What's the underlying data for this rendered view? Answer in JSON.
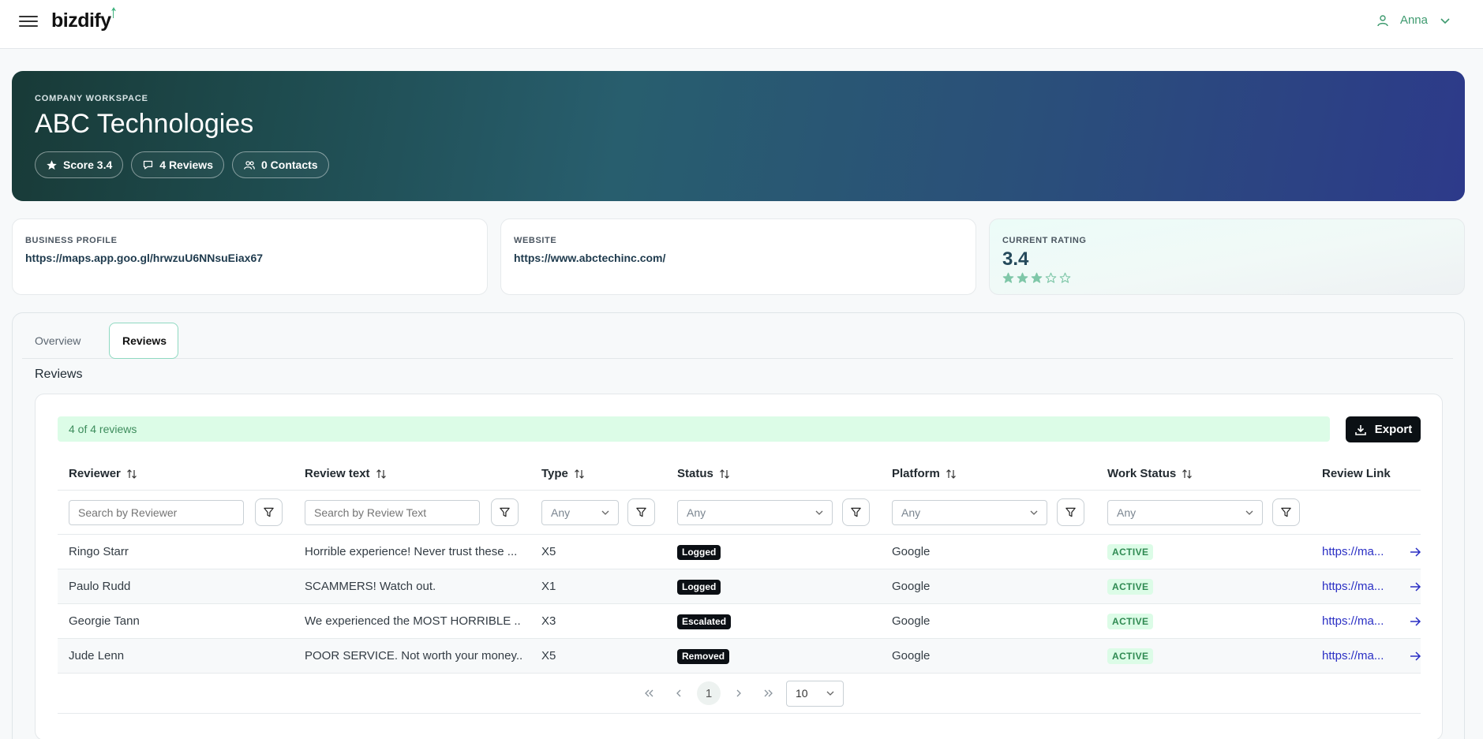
{
  "header": {
    "logo": "bizdify",
    "user_name": "Anna"
  },
  "hero": {
    "eyebrow": "COMPANY WORKSPACE",
    "title": "ABC Technologies",
    "chips": {
      "score": "Score 3.4",
      "reviews": "4 Reviews",
      "contacts": "0 Contacts"
    }
  },
  "cards": {
    "business_profile": {
      "label": "BUSINESS PROFILE",
      "value": "https://maps.app.goo.gl/hrwzuU6NNsuEiax67"
    },
    "website": {
      "label": "WEBSITE",
      "value": "https://www.abctechinc.com/"
    },
    "rating": {
      "label": "CURRENT RATING",
      "value": "3.4",
      "stars_filled": 3,
      "stars_total": 5
    }
  },
  "tabs": {
    "overview": "Overview",
    "reviews": "Reviews"
  },
  "reviews": {
    "section_title": "Reviews",
    "count_text": "4 of 4 reviews",
    "export_label": "Export",
    "columns": {
      "reviewer": "Reviewer",
      "review_text": "Review text",
      "type": "Type",
      "status": "Status",
      "platform": "Platform",
      "work_status": "Work Status",
      "review_link": "Review Link"
    },
    "filters": {
      "reviewer_placeholder": "Search by Reviewer",
      "text_placeholder": "Search by Review Text",
      "type": "Any",
      "status": "Any",
      "platform": "Any",
      "work_status": "Any"
    },
    "rows": [
      {
        "reviewer": "Ringo Starr",
        "text": "Horrible experience! Never trust these ...",
        "type": "X5",
        "status": "Logged",
        "platform": "Google",
        "work_status": "ACTIVE",
        "link": "https://ma..."
      },
      {
        "reviewer": "Paulo Rudd",
        "text": "SCAMMERS! Watch out.",
        "type": "X1",
        "status": "Logged",
        "platform": "Google",
        "work_status": "ACTIVE",
        "link": "https://ma..."
      },
      {
        "reviewer": "Georgie Tann",
        "text": "We experienced the MOST HORRIBLE ...",
        "type": "X3",
        "status": "Escalated",
        "platform": "Google",
        "work_status": "ACTIVE",
        "link": "https://ma..."
      },
      {
        "reviewer": "Jude Lenn",
        "text": "POOR SERVICE. Not worth your money...",
        "type": "X5",
        "status": "Removed",
        "platform": "Google",
        "work_status": "ACTIVE",
        "link": "https://ma..."
      }
    ],
    "pagination": {
      "current_page": "1",
      "page_size": "10"
    }
  },
  "colors": {
    "accent_green": "#3e9a6f",
    "star": "#7fc7a8",
    "link": "#2a2fc4"
  }
}
